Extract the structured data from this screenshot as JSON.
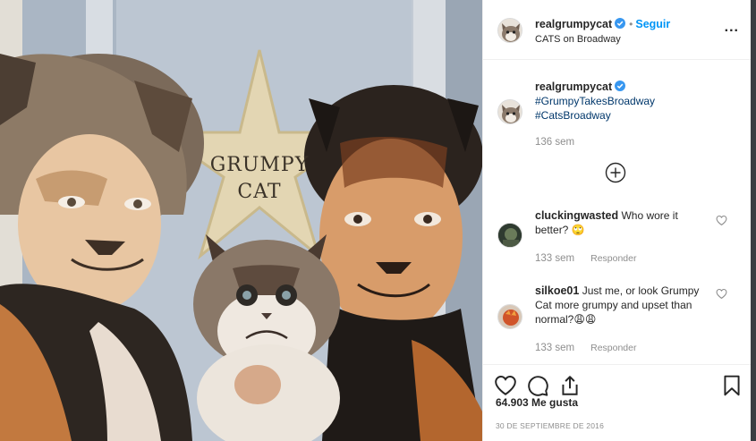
{
  "post": {
    "username": "realgrumpycat",
    "follow_label": "Seguir",
    "dot": "•",
    "location": "CATS on Broadway",
    "more": "...",
    "photo_sign_line1": "GRUMPY",
    "photo_sign_line2": "CAT"
  },
  "caption": {
    "username": "realgrumpycat",
    "hashtags": [
      "#GrumpyTakesBroadway",
      "#CatsBroadway"
    ],
    "time": "136 sem"
  },
  "comments": [
    {
      "username": "cluckingwasted",
      "text": "Who wore it better? 🙄",
      "time": "133 sem",
      "reply": "Responder"
    },
    {
      "username": "silkoe01",
      "text": "Just me, or look Grumpy Cat more grumpy and upset than normal?😩😩",
      "time": "133 sem",
      "reply": "Responder"
    }
  ],
  "footer": {
    "likes": "64.903 Me gusta",
    "date": "30 DE SEPTIEMBRE DE 2016"
  },
  "colors": {
    "link_blue": "#0095f6",
    "hashtag_blue": "#00376b",
    "muted": "#8e8e8e",
    "verified": "#3897f0"
  },
  "icons": [
    "verified-badge-icon",
    "more-options-icon",
    "load-more-plus-icon",
    "heart-icon",
    "comment-icon",
    "share-icon",
    "bookmark-icon"
  ]
}
